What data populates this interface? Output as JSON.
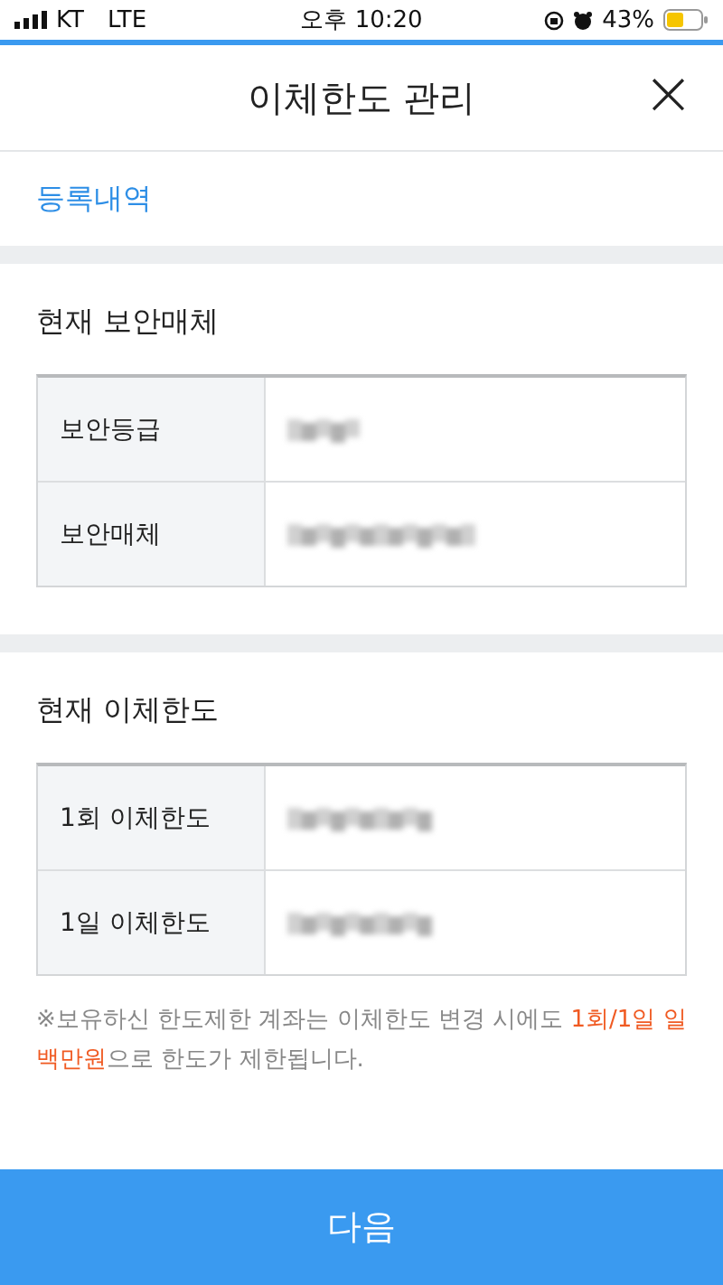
{
  "status_bar": {
    "carrier": "KT",
    "network": "LTE",
    "time": "오후 10:20",
    "battery": "43%"
  },
  "header": {
    "title": "이체한도 관리",
    "close": "×"
  },
  "link": "등록내역",
  "sections": [
    {
      "title": "현재 보안매체",
      "rows": [
        {
          "label": "보안등급"
        },
        {
          "label": "보안매체"
        }
      ]
    },
    {
      "title": "현재 이체한도",
      "rows": [
        {
          "label": "1회 이체한도"
        },
        {
          "label": "1일 이체한도"
        }
      ]
    }
  ],
  "note": {
    "mark": "※",
    "parts": [
      {
        "text": "보유하신 한도제한 계좌는 이체한도 변경 시에도 ",
        "highlight": false
      },
      {
        "text": "1회/1일 일 백만원",
        "highlight": true
      },
      {
        "text": "으로 한도가 제한됩니다.",
        "highlight": false
      }
    ]
  },
  "next_button": "다음"
}
